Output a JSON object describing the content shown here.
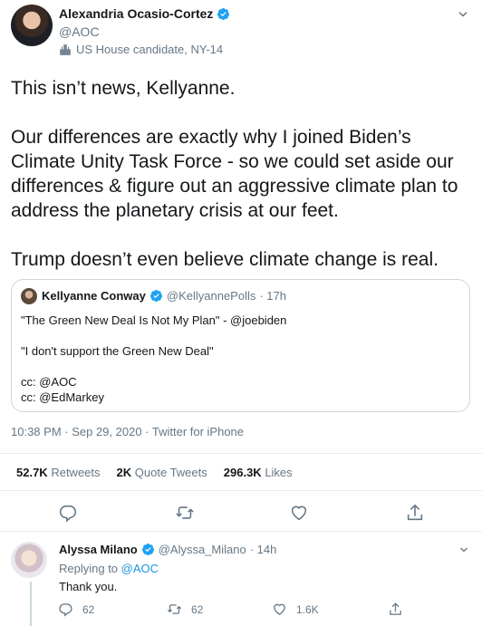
{
  "main_tweet": {
    "author_name": "Alexandria Ocasio-Cortez",
    "handle": "@AOC",
    "label": "US House candidate, NY-14",
    "text": [
      "This isn’t news, Kellyanne.",
      "Our differences are exactly why I joined Biden’s Climate Unity Task Force - so we could set aside our differences & figure out an aggressive climate plan to address the planetary crisis at our feet.",
      "Trump doesn’t even believe climate change is real."
    ],
    "timestamp": "10:38 PM · Sep 29, 2020 · Twitter for iPhone"
  },
  "quoted_tweet": {
    "author_name": "Kellyanne Conway",
    "handle": "@KellyannePolls",
    "time": "· 17h",
    "lines": [
      "\"The Green New Deal Is Not My Plan\" - @joebiden",
      "",
      "\"I don't support the Green New Deal\"",
      "",
      "cc: @AOC",
      "cc: @EdMarkey"
    ]
  },
  "stats": {
    "retweets_count": "52.7K",
    "retweets_label": "Retweets",
    "quotes_count": "2K",
    "quotes_label": "Quote Tweets",
    "likes_count": "296.3K",
    "likes_label": "Likes"
  },
  "reply": {
    "author_name": "Alyssa Milano",
    "handle": "@Alyssa_Milano",
    "time": "· 14h",
    "replying_prefix": "Replying to",
    "replying_to": "@AOC",
    "text": "Thank you.",
    "reply_count": "62",
    "retweet_count": "62",
    "like_count": "1.6K"
  },
  "colors": {
    "verified": "#1da1f2",
    "link": "#1b95e0",
    "muted": "#657786"
  },
  "icons": [
    "verified-icon",
    "ballot-box-icon",
    "chevron-down-icon",
    "reply-icon",
    "retweet-icon",
    "like-icon",
    "share-icon"
  ]
}
